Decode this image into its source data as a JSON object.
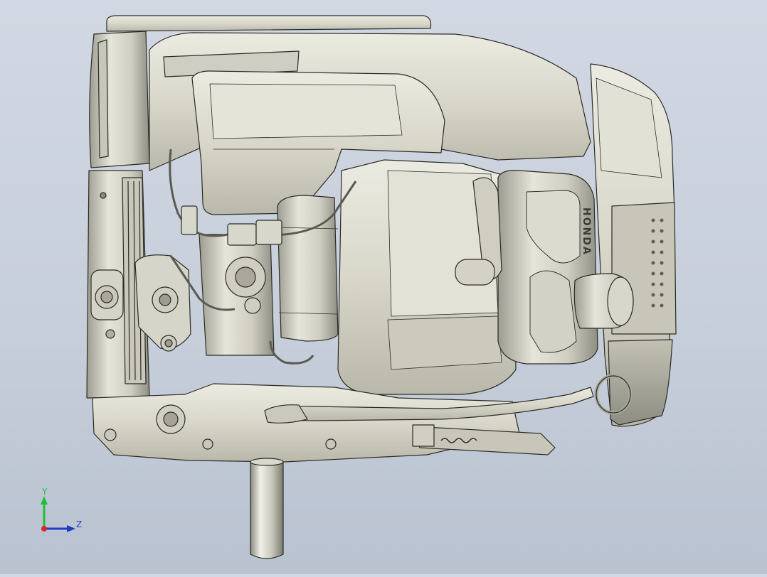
{
  "viewport": {
    "background_top": "#d2d8e3",
    "background_bottom": "#b9c2d0",
    "model_fill": "#dfded2",
    "model_shade": "#b7b6a8",
    "model_dark": "#8e8d82",
    "edge_color": "#2b2b26"
  },
  "model": {
    "brand_label": "HONDA"
  },
  "triad": {
    "y_label": "Y",
    "z_label": "Z",
    "y_color": "#1fbf3a",
    "z_color": "#1f3cc9",
    "x_color": "#d62a2a",
    "icon": "coordinate-triad-icon"
  }
}
